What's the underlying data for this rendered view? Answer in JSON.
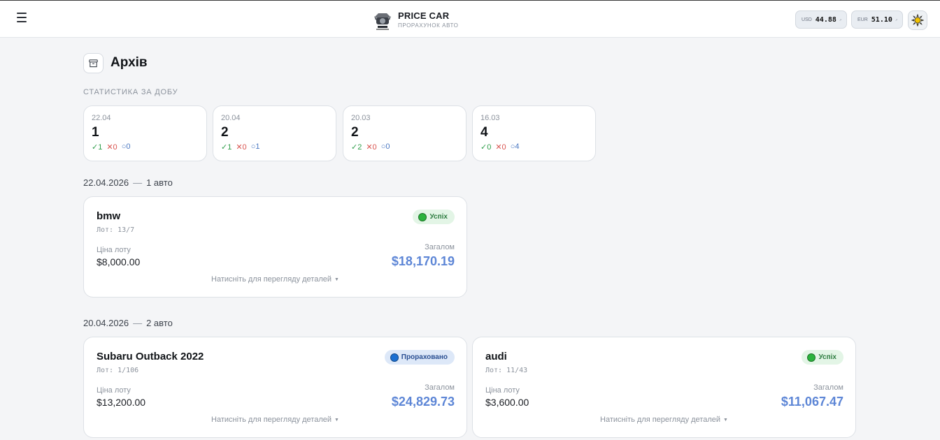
{
  "header": {
    "brand_title": "PRICE CAR",
    "brand_subtitle": "ПРОРАХУНОК АВТО",
    "rates": [
      {
        "currency": "USD",
        "value": "44.88",
        "change": "↗"
      },
      {
        "currency": "EUR",
        "value": "51.10",
        "change": "↗"
      }
    ],
    "icons": {
      "menu": "menu-icon",
      "logo": "logo-icon",
      "theme": "sun-icon"
    }
  },
  "page": {
    "title": "Архів",
    "stats_label": "СТАТИСТИКА ЗА ДОБУ"
  },
  "stats": [
    {
      "date": "22.04",
      "count": "1",
      "ok": "✓1",
      "fail": "✕0",
      "pending": "○0"
    },
    {
      "date": "20.04",
      "count": "2",
      "ok": "✓1",
      "fail": "✕0",
      "pending": "○1"
    },
    {
      "date": "20.03",
      "count": "2",
      "ok": "✓2",
      "fail": "✕0",
      "pending": "○0"
    },
    {
      "date": "16.03",
      "count": "4",
      "ok": "✓0",
      "fail": "✕0",
      "pending": "○4"
    }
  ],
  "groups": [
    {
      "date": "22.04.2026",
      "separator": "—",
      "count_label": "1 авто",
      "cars": [
        {
          "name": "bmw",
          "lot": "Лот: 13/7",
          "status": "Успіх",
          "price_label": "Ціна лоту",
          "price": "$8,000.00",
          "total_label": "Загалом",
          "total": "$18,170.19",
          "hint": "Натисніть для перегляду деталей",
          "caret": "▼"
        }
      ]
    },
    {
      "date": "20.04.2026",
      "separator": "—",
      "count_label": "2 авто",
      "cars": [
        {
          "name": "Subaru Outback 2022",
          "lot": "Лот: 1/106",
          "status": "Прораховано",
          "price_label": "Ціна лоту",
          "price": "$13,200.00",
          "total_label": "Загалом",
          "total": "$24,829.73",
          "hint": "Натисніть для перегляду деталей",
          "caret": "▼"
        },
        {
          "name": "audi",
          "lot": "Лот: 11/43",
          "status": "Успіх",
          "price_label": "Ціна лоту",
          "price": "$3,600.00",
          "total_label": "Загалом",
          "total": "$11,067.47",
          "hint": "Натисніть для перегляду деталей",
          "caret": "▼"
        }
      ]
    }
  ],
  "colors": {
    "accent_total": "#5d86d6",
    "success": "#2bb33d",
    "calculated": "#1b6fd1"
  }
}
